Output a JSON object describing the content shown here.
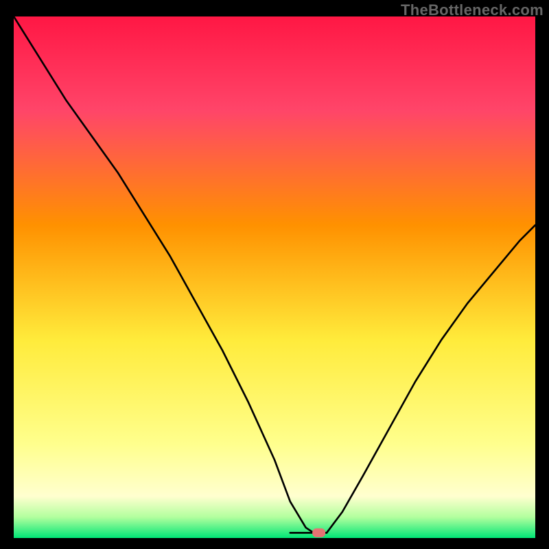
{
  "watermark": "TheBottleneck.com",
  "colors": {
    "top": "#ff1744",
    "mid_upper": "#ff9100",
    "mid": "#ffeb3b",
    "lower_yellow": "#ffff8d",
    "green": "#00e676",
    "curve": "#000000",
    "marker": "#e57373",
    "frame": "#000000"
  },
  "chart_data": {
    "type": "line",
    "title": "",
    "xlabel": "",
    "ylabel": "",
    "xlim": [
      0,
      100
    ],
    "ylim": [
      0,
      100
    ],
    "grid": false,
    "series": [
      {
        "name": "left-curve",
        "x": [
          0,
          5,
          10,
          15,
          20,
          25,
          30,
          35,
          40,
          45,
          50,
          53,
          56,
          57.5
        ],
        "y": [
          100,
          92,
          84,
          77,
          70,
          62,
          54,
          45,
          36,
          26,
          15,
          7,
          2,
          1
        ]
      },
      {
        "name": "right-curve",
        "x": [
          60,
          63,
          67,
          72,
          77,
          82,
          87,
          92,
          97,
          100
        ],
        "y": [
          1,
          5,
          12,
          21,
          30,
          38,
          45,
          51,
          57,
          60
        ]
      },
      {
        "name": "flat-minimum",
        "x": [
          53,
          60
        ],
        "y": [
          1,
          1
        ]
      }
    ],
    "marker": {
      "x": 58.5,
      "y": 1,
      "w": 2.6,
      "h": 1.6
    },
    "gradient_stops": [
      {
        "pct": 0,
        "color": "#ff1744"
      },
      {
        "pct": 18,
        "color": "#ff4569"
      },
      {
        "pct": 40,
        "color": "#ff9100"
      },
      {
        "pct": 62,
        "color": "#ffeb3b"
      },
      {
        "pct": 82,
        "color": "#ffff8d"
      },
      {
        "pct": 92,
        "color": "#ffffcf"
      },
      {
        "pct": 96,
        "color": "#b2ff9e"
      },
      {
        "pct": 100,
        "color": "#00e676"
      }
    ]
  }
}
